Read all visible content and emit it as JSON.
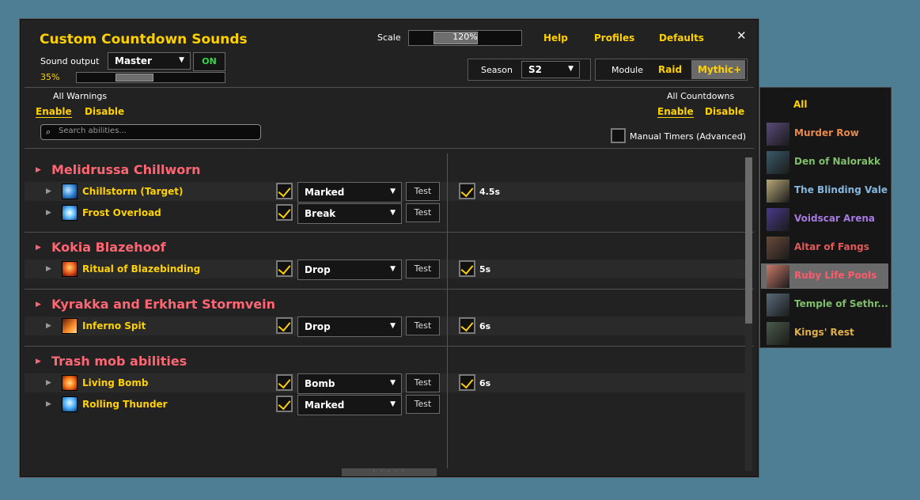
{
  "header": {
    "title": "Custom Countdown Sounds",
    "sound_output_label": "Sound output",
    "sound_output_value": "Master",
    "toggle_label": "ON",
    "volume_text": "35%",
    "volume_fraction": 0.35,
    "scale_label": "Scale",
    "scale_value": "120%",
    "help": "Help",
    "profiles": "Profiles",
    "defaults": "Defaults",
    "close": "✕",
    "season_label": "Season",
    "season_value": "S2",
    "module_label": "Module",
    "module_raid": "Raid",
    "module_mythic": "Mythic+"
  },
  "warnings": {
    "label": "All Warnings",
    "enable": "Enable",
    "disable": "Disable"
  },
  "countdowns": {
    "label": "All Countdowns",
    "enable": "Enable",
    "disable": "Disable"
  },
  "search": {
    "placeholder": "Search abilities..."
  },
  "manual_timers": {
    "label": "Manual Timers (Advanced)",
    "checked": false
  },
  "groups": [
    {
      "name": "Melidrussa Chillworn",
      "abilities": [
        {
          "name": "Chillstorm (Target)",
          "icon": "frost-swirl-icon",
          "warn": true,
          "sound": "Marked",
          "test": "Test",
          "countdown": true,
          "time": "4.5s"
        },
        {
          "name": "Frost Overload",
          "icon": "frost-burst-icon",
          "warn": true,
          "sound": "Break",
          "test": "Test",
          "countdown": false,
          "time": ""
        }
      ]
    },
    {
      "name": "Kokia Blazehoof",
      "abilities": [
        {
          "name": "Ritual of Blazebinding",
          "icon": "fire-ritual-icon",
          "warn": true,
          "sound": "Drop",
          "test": "Test",
          "countdown": true,
          "time": "5s"
        }
      ]
    },
    {
      "name": "Kyrakka and Erkhart Stormvein",
      "abilities": [
        {
          "name": "Inferno Spit",
          "icon": "fire-spit-icon",
          "warn": true,
          "sound": "Drop",
          "test": "Test",
          "countdown": true,
          "time": "6s"
        }
      ]
    },
    {
      "name": "Trash mob abilities",
      "abilities": [
        {
          "name": "Living Bomb",
          "icon": "living-bomb-icon",
          "warn": true,
          "sound": "Bomb",
          "test": "Test",
          "countdown": true,
          "time": "6s"
        },
        {
          "name": "Rolling Thunder",
          "icon": "lightning-icon",
          "warn": true,
          "sound": "Marked",
          "test": "Test",
          "countdown": false,
          "time": ""
        }
      ]
    }
  ],
  "dungeon_menu": {
    "all": "All",
    "items": [
      {
        "name": "Murder Row",
        "color": "#e8894a",
        "thumb": "#5a4a7a",
        "selected": false
      },
      {
        "name": "Den of Nalorakk",
        "color": "#7fbf6a",
        "thumb": "#3b5a6a",
        "selected": false
      },
      {
        "name": "The Blinding Vale",
        "color": "#86b8e0",
        "thumb": "#b8a878",
        "selected": false
      },
      {
        "name": "Voidscar Arena",
        "color": "#a77ae0",
        "thumb": "#4a3a8a",
        "selected": false
      },
      {
        "name": "Altar of Fangs",
        "color": "#e05a5a",
        "thumb": "#6a4a3a",
        "selected": false
      },
      {
        "name": "Ruby Life Pools",
        "color": "#ff5a6a",
        "thumb": "#c87a6a",
        "selected": true
      },
      {
        "name": "Temple of Sethr...",
        "color": "#7fbf6a",
        "thumb": "#5a6a7a",
        "selected": false
      },
      {
        "name": "Kings' Rest",
        "color": "#e0b04a",
        "thumb": "#4a5a4a",
        "selected": false
      }
    ]
  }
}
